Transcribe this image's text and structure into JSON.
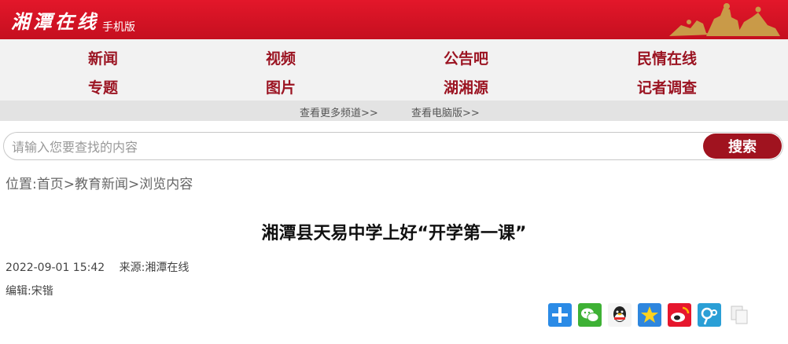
{
  "header": {
    "logo_text": "湘潭在线",
    "logo_sub": "手机版"
  },
  "nav": {
    "items": [
      {
        "label": "新闻"
      },
      {
        "label": "视频"
      },
      {
        "label": "公告吧"
      },
      {
        "label": "民情在线"
      },
      {
        "label": "专题"
      },
      {
        "label": "图片"
      },
      {
        "label": "湖湘源"
      },
      {
        "label": "记者调查"
      }
    ],
    "more_channels": "查看更多频道>>",
    "pc_version": "查看电脑版>>"
  },
  "search": {
    "placeholder": "请输入您要查找的内容",
    "button_label": "搜索"
  },
  "breadcrumb": {
    "prefix": "位置:",
    "home": "首页",
    "sep": ">",
    "section": "教育新闻",
    "current": "浏览内容"
  },
  "article": {
    "title": "湘潭县天易中学上好“开学第一课”",
    "datetime": "2022-09-01 15:42",
    "source_label": "来源:",
    "source": "湘潭在线",
    "editor_label": "编辑:",
    "editor": "宋锴"
  },
  "share": {
    "buttons": [
      {
        "icon": "plus-icon",
        "color": "#2b8be6"
      },
      {
        "icon": "wechat-icon",
        "color": "#3eb135"
      },
      {
        "icon": "qq-icon",
        "color": "#f2f2f2"
      },
      {
        "icon": "star-icon",
        "color": "#2e86de"
      },
      {
        "icon": "weibo-icon",
        "color": "#e6162d"
      },
      {
        "icon": "tencent-weibo-icon",
        "color": "#2a9fd6"
      },
      {
        "icon": "copy-icon",
        "color": "#eeeeee"
      }
    ]
  },
  "colors": {
    "brand_red": "#d7152a",
    "nav_text": "#9b1422",
    "button_red": "#a0131f"
  }
}
